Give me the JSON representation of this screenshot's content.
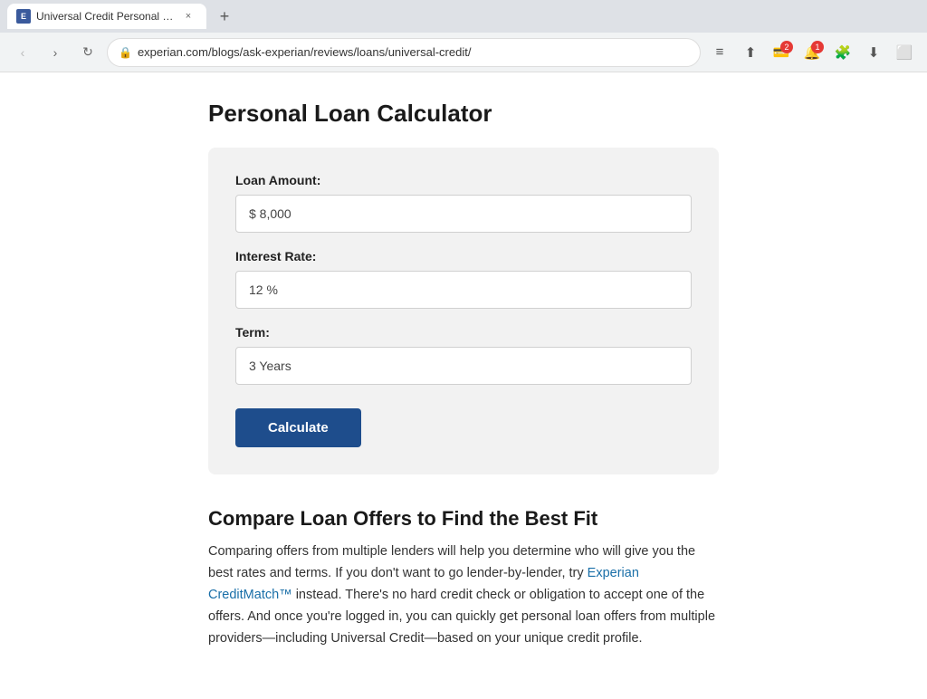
{
  "browser": {
    "tab_title": "Universal Credit Personal Loan Re",
    "tab_favicon_label": "E",
    "tab_close": "×",
    "new_tab_icon": "+",
    "nav_back": "‹",
    "nav_forward": "›",
    "nav_reload": "↻",
    "address_url": "experian.com/blogs/ask-experian/reviews/loans/universal-credit/",
    "lock_icon": "🔒",
    "toolbar_menu": "≡",
    "toolbar_share": "⬆",
    "toolbar_extensions": "🧩",
    "toolbar_download": "⬇",
    "toolbar_window": "⬜"
  },
  "calculator": {
    "page_title": "Personal Loan Calculator",
    "loan_amount_label": "Loan Amount:",
    "loan_amount_value": "$ 8,000",
    "interest_rate_label": "Interest Rate:",
    "interest_rate_value": "12 %",
    "term_label": "Term:",
    "term_value": "3 Years",
    "calculate_button_label": "Calculate"
  },
  "compare_section": {
    "title": "Compare Loan Offers to Find the Best Fit",
    "body_part1": "Comparing offers from multiple lenders will help you determine who will give you the best rates and terms. If you don't want to go lender-by-lender, try ",
    "link_text": "Experian CreditMatch™",
    "body_part2": " instead. There's no hard credit check or obligation to accept one of the offers. And once you're logged in, you can quickly get personal loan offers from multiple providers—including Universal Credit—based on your unique credit profile."
  }
}
